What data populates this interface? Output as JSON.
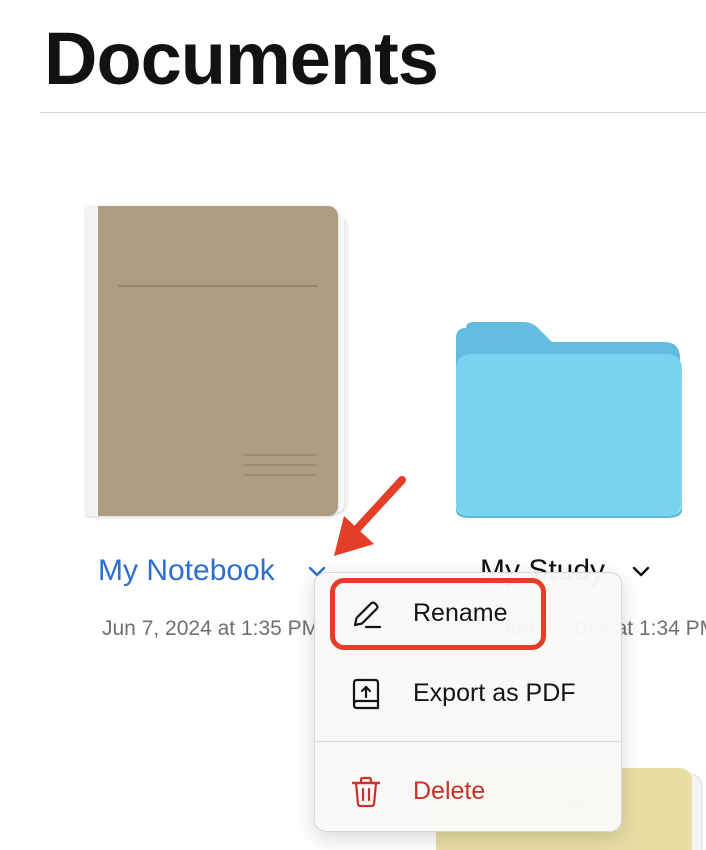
{
  "header": {
    "title": "Documents"
  },
  "items": [
    {
      "name": "My Notebook",
      "date": "Jun 7, 2024 at 1:35 PM",
      "type": "notebook",
      "color": "#ad9c82"
    },
    {
      "name": "My Study",
      "date": "Jun 7, 2024 at 1:34 PM",
      "type": "folder",
      "color": "#79d3f0"
    }
  ],
  "context_menu": {
    "items": [
      {
        "label": "Rename",
        "icon": "pencil-icon"
      },
      {
        "label": "Export as PDF",
        "icon": "export-pdf-icon"
      },
      {
        "label": "Delete",
        "icon": "trash-icon",
        "color": "#c8322b"
      }
    ]
  },
  "annotation": {
    "color": "#e53e28"
  }
}
